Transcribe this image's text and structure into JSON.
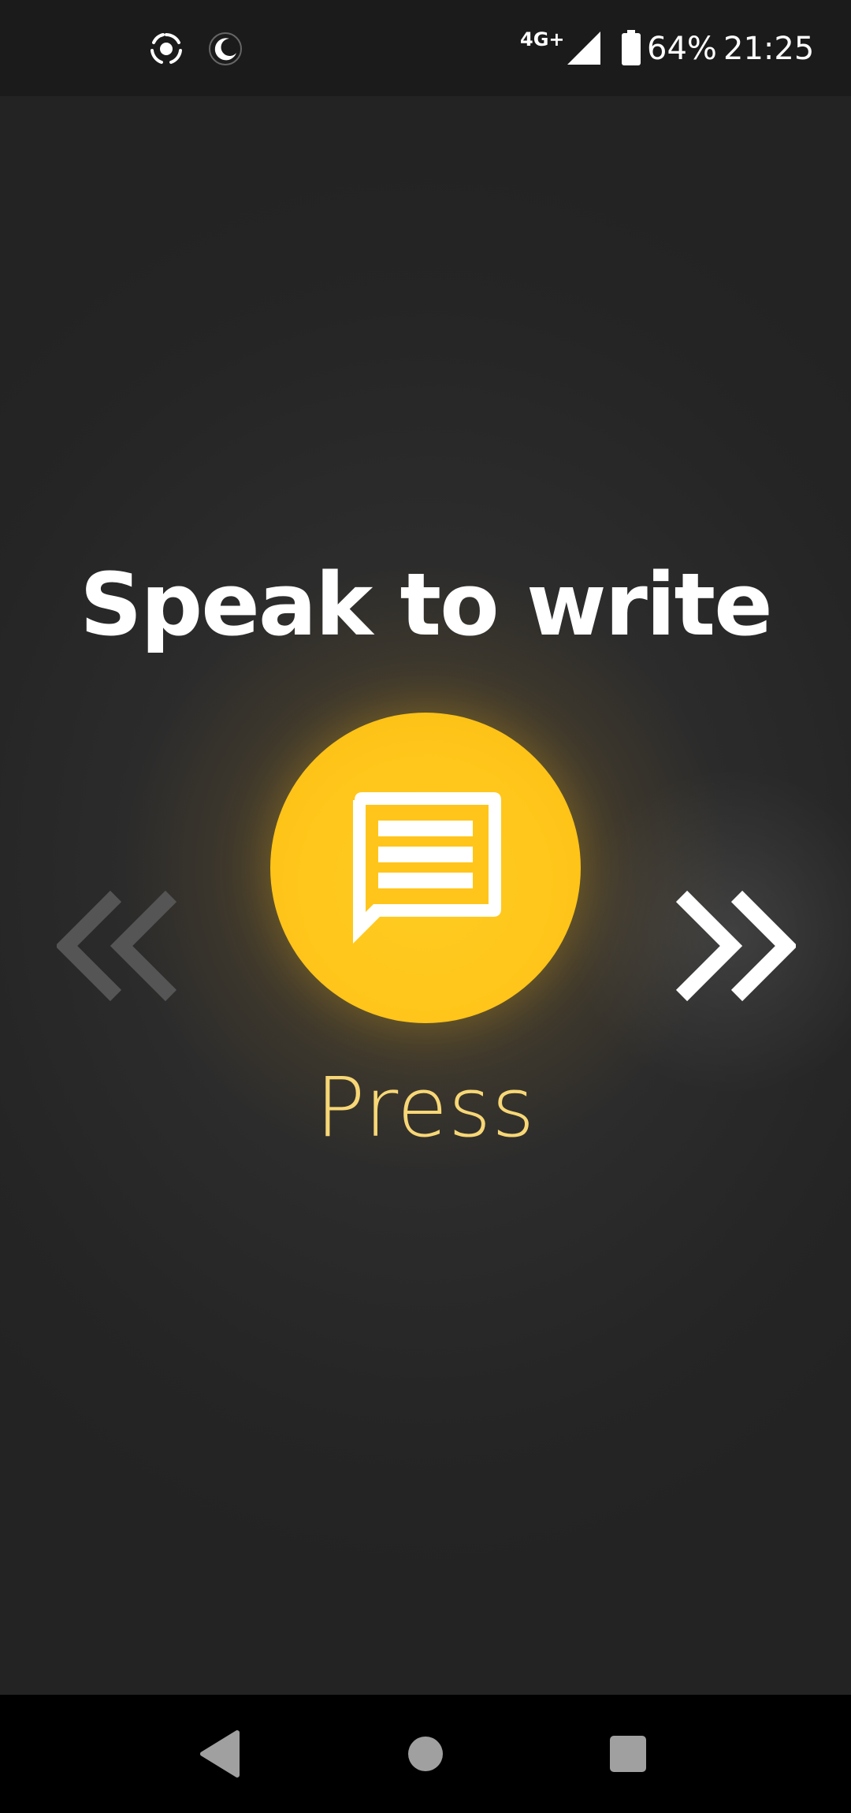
{
  "status_bar": {
    "network_type": "4G+",
    "battery_percent": "64%",
    "battery_level": 0.64,
    "time": "21:25",
    "icons": [
      "screen-record-icon",
      "do-not-disturb-moon-icon",
      "cellular-signal-icon",
      "battery-icon"
    ]
  },
  "main": {
    "title": "Speak to write",
    "press_label": "Press",
    "center_icon": "message-lines-icon",
    "prev_icon": "double-chevron-left-icon",
    "next_icon": "double-chevron-right-icon"
  },
  "navigation_bar": {
    "buttons": [
      "back-icon",
      "home-icon",
      "recents-icon"
    ]
  },
  "colors": {
    "accent": "#ffc51a",
    "press_text": "#f7d776",
    "background": "#242424",
    "status_bar": "#1b1b1b",
    "nav_bar": "#000000",
    "nav_icons": "#a0a0a0",
    "prev_arrow": "#555555",
    "next_arrow": "#ffffff"
  }
}
